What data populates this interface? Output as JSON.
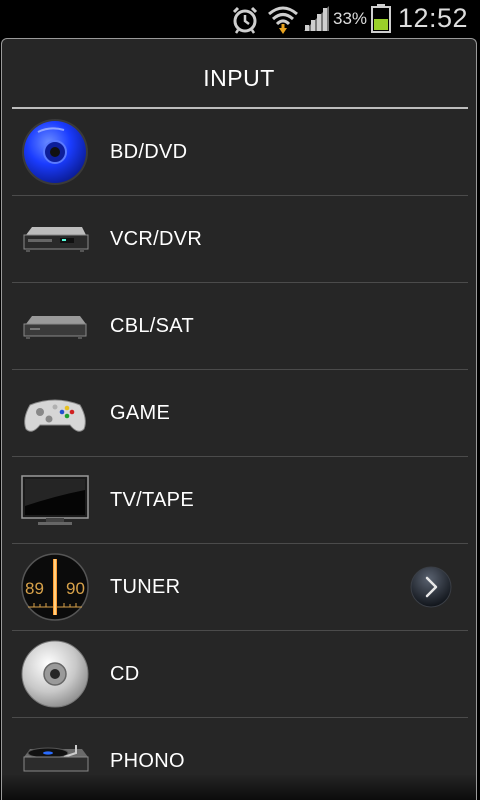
{
  "status_bar": {
    "battery_percent": "33%",
    "time": "12:52",
    "icons": [
      "alarm-icon",
      "wifi-icon",
      "signal-icon",
      "battery-icon"
    ]
  },
  "dialog": {
    "title": "INPUT",
    "items": [
      {
        "label": "BD/DVD",
        "icon": "bluray-disc-icon"
      },
      {
        "label": "VCR/DVR",
        "icon": "vcr-player-icon"
      },
      {
        "label": "CBL/SAT",
        "icon": "set-top-box-icon"
      },
      {
        "label": "GAME",
        "icon": "game-controller-icon"
      },
      {
        "label": "TV/TAPE",
        "icon": "tv-icon"
      },
      {
        "label": "TUNER",
        "icon": "tuner-dial-icon",
        "has_arrow": true,
        "dial_values": [
          "89",
          "90"
        ]
      },
      {
        "label": "CD",
        "icon": "cd-disc-icon"
      },
      {
        "label": "PHONO",
        "icon": "turntable-icon"
      }
    ]
  }
}
